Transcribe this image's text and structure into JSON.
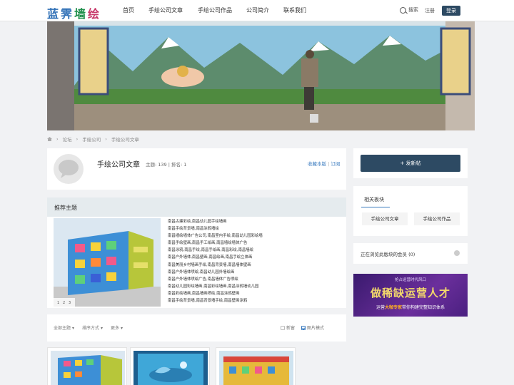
{
  "logo": {
    "chars": [
      "蓝",
      "霁",
      "墙",
      "绘"
    ]
  },
  "nav": {
    "items": [
      {
        "label": "首页"
      },
      {
        "label": "手绘公司文章"
      },
      {
        "label": "手绘公司作品"
      },
      {
        "label": "公司简介"
      },
      {
        "label": "联系我们"
      }
    ]
  },
  "header": {
    "search_label": "搜索",
    "register_label": "注册",
    "login_label": "登录"
  },
  "breadcrumb": {
    "items": [
      "论坛",
      "手绘公司",
      "手绘公司文章"
    ]
  },
  "forum": {
    "title": "手绘公司文章",
    "stats": "主题: 139  |  排名: 1",
    "favorite": "收藏本版",
    "subscribe": "订阅"
  },
  "recommended": {
    "title": "推荐主题",
    "items": [
      "南昌古建彩绘,南昌幼儿园手绘墙画",
      "南昌手绘背景墙,南昌涂鸦墙绘",
      "南昌墙绘墙体广告公司,南昌室内手绘,南昌幼儿园彩绘墙",
      "南昌手绘壁画,南昌手工绘画,南昌墙绘墙体广告",
      "南昌涂鸦,南昌手绘,南昌手绘画,南昌彩绘,南昌墙绘",
      "南昌户外墙体,南昌壁画,南昌绘画,南昌手绘立体画",
      "南昌美丽乡村墙画手绘,南昌背景墙,南昌墙体壁画",
      "南昌户外墙体喷绘,南昌幼儿园外墙绘画",
      "南昌户外墙体喷绘广告,南昌墙体广告喷绘",
      "南昌幼儿园彩绘墙画,南昌彩绘墙画,南昌涂鸦墙幼儿园",
      "南昌彩绘墙画,南昌墙画喷绘,南昌涂鸦壁画",
      "南昌手绘背景墙,南昌背景墙手绘,南昌壁画涂鸦"
    ],
    "pager": [
      "1",
      "2",
      "3"
    ]
  },
  "filter": {
    "all": "全部主题",
    "sort": "排序方式",
    "more": "更多",
    "new": "新窗",
    "image_mode": "图片模式"
  },
  "sidebar": {
    "post_button": "+ 发新帖",
    "related_title": "相关板块",
    "related": [
      "手绘公司文章",
      "手绘公司作品"
    ],
    "browsing": "正在浏览此版块的会员 (0)"
  },
  "ad": {
    "line1": "抢占运营时代风口",
    "line2": "做稀缺运营人才",
    "line3_pre": "运营",
    "line3_hi": "大咖专家",
    "line3_post": "带你构建完整知识体系"
  },
  "colors": {
    "accent": "#2d4a63",
    "link": "#3a7bbf"
  }
}
